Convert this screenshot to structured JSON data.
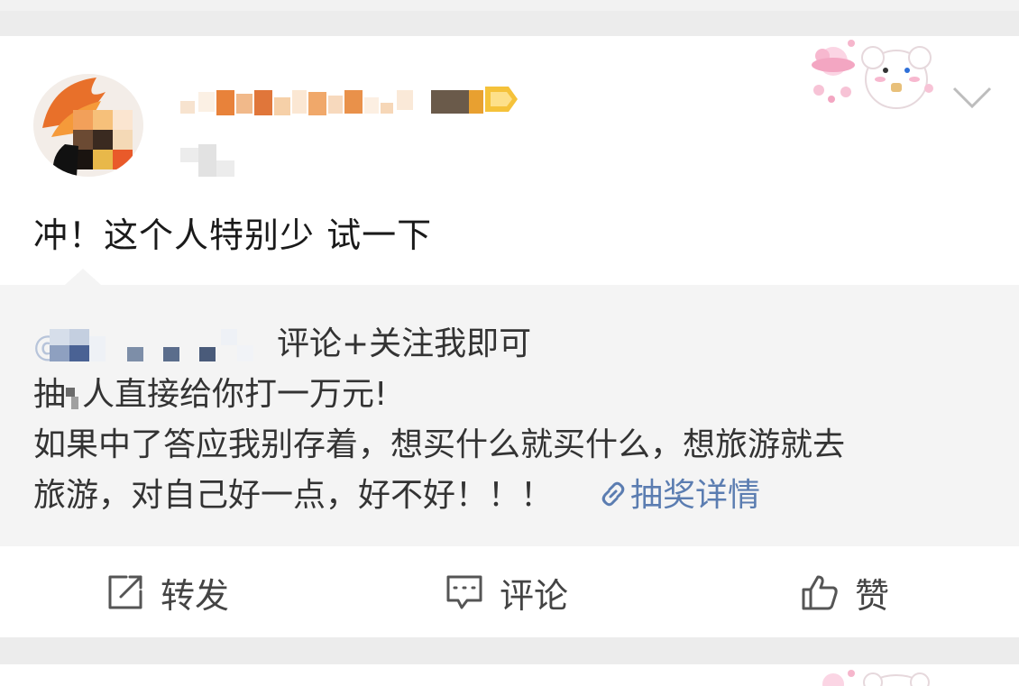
{
  "post": {
    "text": "冲！这个人特别少 试一下",
    "menu_icon": "chevron-down-icon"
  },
  "repost": {
    "mention_prefix": "@",
    "line1_suffix": "评论+关注我即可",
    "line2": "抽",
    "line2_rest": "人直接给你打一万元!",
    "line3": "如果中了答应我别存着，想买什么就买什么，想旅游就去",
    "line4": "旅游，对自己好一点，好不好！！！",
    "link_label": "抽奖详情",
    "link_icon": "link-icon"
  },
  "actions": {
    "repost_label": "转发",
    "comment_label": "评论",
    "like_label": "赞"
  },
  "colors": {
    "link": "#5b7db1",
    "text": "#1a1a1a",
    "repost_bg": "#f4f4f4"
  }
}
